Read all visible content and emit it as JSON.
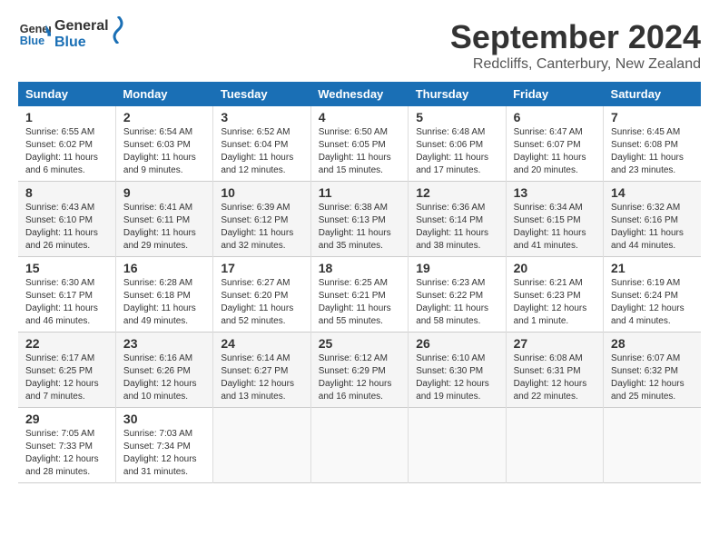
{
  "header": {
    "logo_line1": "General",
    "logo_line2": "Blue",
    "main_title": "September 2024",
    "subtitle": "Redcliffs, Canterbury, New Zealand"
  },
  "calendar": {
    "days_of_week": [
      "Sunday",
      "Monday",
      "Tuesday",
      "Wednesday",
      "Thursday",
      "Friday",
      "Saturday"
    ],
    "weeks": [
      [
        {
          "day": "1",
          "info": "Sunrise: 6:55 AM\nSunset: 6:02 PM\nDaylight: 11 hours and 6 minutes."
        },
        {
          "day": "2",
          "info": "Sunrise: 6:54 AM\nSunset: 6:03 PM\nDaylight: 11 hours and 9 minutes."
        },
        {
          "day": "3",
          "info": "Sunrise: 6:52 AM\nSunset: 6:04 PM\nDaylight: 11 hours and 12 minutes."
        },
        {
          "day": "4",
          "info": "Sunrise: 6:50 AM\nSunset: 6:05 PM\nDaylight: 11 hours and 15 minutes."
        },
        {
          "day": "5",
          "info": "Sunrise: 6:48 AM\nSunset: 6:06 PM\nDaylight: 11 hours and 17 minutes."
        },
        {
          "day": "6",
          "info": "Sunrise: 6:47 AM\nSunset: 6:07 PM\nDaylight: 11 hours and 20 minutes."
        },
        {
          "day": "7",
          "info": "Sunrise: 6:45 AM\nSunset: 6:08 PM\nDaylight: 11 hours and 23 minutes."
        }
      ],
      [
        {
          "day": "8",
          "info": "Sunrise: 6:43 AM\nSunset: 6:10 PM\nDaylight: 11 hours and 26 minutes."
        },
        {
          "day": "9",
          "info": "Sunrise: 6:41 AM\nSunset: 6:11 PM\nDaylight: 11 hours and 29 minutes."
        },
        {
          "day": "10",
          "info": "Sunrise: 6:39 AM\nSunset: 6:12 PM\nDaylight: 11 hours and 32 minutes."
        },
        {
          "day": "11",
          "info": "Sunrise: 6:38 AM\nSunset: 6:13 PM\nDaylight: 11 hours and 35 minutes."
        },
        {
          "day": "12",
          "info": "Sunrise: 6:36 AM\nSunset: 6:14 PM\nDaylight: 11 hours and 38 minutes."
        },
        {
          "day": "13",
          "info": "Sunrise: 6:34 AM\nSunset: 6:15 PM\nDaylight: 11 hours and 41 minutes."
        },
        {
          "day": "14",
          "info": "Sunrise: 6:32 AM\nSunset: 6:16 PM\nDaylight: 11 hours and 44 minutes."
        }
      ],
      [
        {
          "day": "15",
          "info": "Sunrise: 6:30 AM\nSunset: 6:17 PM\nDaylight: 11 hours and 46 minutes."
        },
        {
          "day": "16",
          "info": "Sunrise: 6:28 AM\nSunset: 6:18 PM\nDaylight: 11 hours and 49 minutes."
        },
        {
          "day": "17",
          "info": "Sunrise: 6:27 AM\nSunset: 6:20 PM\nDaylight: 11 hours and 52 minutes."
        },
        {
          "day": "18",
          "info": "Sunrise: 6:25 AM\nSunset: 6:21 PM\nDaylight: 11 hours and 55 minutes."
        },
        {
          "day": "19",
          "info": "Sunrise: 6:23 AM\nSunset: 6:22 PM\nDaylight: 11 hours and 58 minutes."
        },
        {
          "day": "20",
          "info": "Sunrise: 6:21 AM\nSunset: 6:23 PM\nDaylight: 12 hours and 1 minute."
        },
        {
          "day": "21",
          "info": "Sunrise: 6:19 AM\nSunset: 6:24 PM\nDaylight: 12 hours and 4 minutes."
        }
      ],
      [
        {
          "day": "22",
          "info": "Sunrise: 6:17 AM\nSunset: 6:25 PM\nDaylight: 12 hours and 7 minutes."
        },
        {
          "day": "23",
          "info": "Sunrise: 6:16 AM\nSunset: 6:26 PM\nDaylight: 12 hours and 10 minutes."
        },
        {
          "day": "24",
          "info": "Sunrise: 6:14 AM\nSunset: 6:27 PM\nDaylight: 12 hours and 13 minutes."
        },
        {
          "day": "25",
          "info": "Sunrise: 6:12 AM\nSunset: 6:29 PM\nDaylight: 12 hours and 16 minutes."
        },
        {
          "day": "26",
          "info": "Sunrise: 6:10 AM\nSunset: 6:30 PM\nDaylight: 12 hours and 19 minutes."
        },
        {
          "day": "27",
          "info": "Sunrise: 6:08 AM\nSunset: 6:31 PM\nDaylight: 12 hours and 22 minutes."
        },
        {
          "day": "28",
          "info": "Sunrise: 6:07 AM\nSunset: 6:32 PM\nDaylight: 12 hours and 25 minutes."
        }
      ],
      [
        {
          "day": "29",
          "info": "Sunrise: 7:05 AM\nSunset: 7:33 PM\nDaylight: 12 hours and 28 minutes."
        },
        {
          "day": "30",
          "info": "Sunrise: 7:03 AM\nSunset: 7:34 PM\nDaylight: 12 hours and 31 minutes."
        },
        {
          "day": "",
          "info": ""
        },
        {
          "day": "",
          "info": ""
        },
        {
          "day": "",
          "info": ""
        },
        {
          "day": "",
          "info": ""
        },
        {
          "day": "",
          "info": ""
        }
      ]
    ]
  }
}
